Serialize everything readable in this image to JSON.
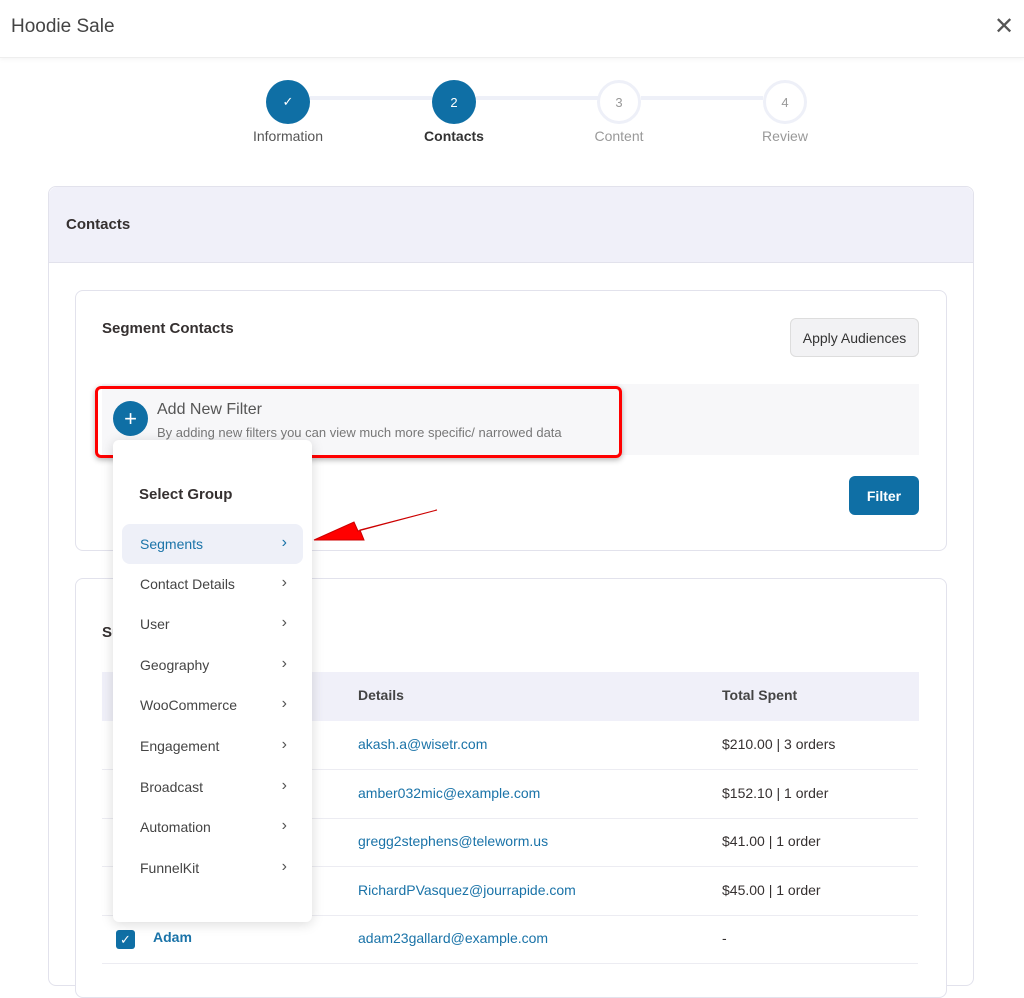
{
  "header": {
    "title": "Hoodie Sale",
    "close_icon": "close-icon"
  },
  "stepper": {
    "steps": [
      {
        "label": "Information",
        "number": "✓",
        "state": "completed"
      },
      {
        "label": "Contacts",
        "number": "2",
        "state": "active"
      },
      {
        "label": "Content",
        "number": "3",
        "state": "pending"
      },
      {
        "label": "Review",
        "number": "4",
        "state": "pending"
      }
    ]
  },
  "contacts": {
    "title": "Contacts",
    "segment": {
      "title": "Segment Contacts",
      "apply_label": "Apply Audiences",
      "add_filter_title": "Add New Filter",
      "add_filter_desc": "By adding new filters you can view much more specific/ narrowed data",
      "filter_label": "Filter"
    },
    "summary": {
      "title_partial": "Su",
      "columns": [
        "Details",
        "Total Spent"
      ],
      "rows": [
        {
          "name": "",
          "email": "akash.a@wisetr.com",
          "spent": "$210.00 | 3 orders"
        },
        {
          "name": "",
          "email": "amber032mic@example.com",
          "spent": "$152.10 | 1 order"
        },
        {
          "name": "",
          "email": "gregg2stephens@teleworm.us",
          "spent": "$41.00 | 1 order"
        },
        {
          "name": "",
          "email": "RichardPVasquez@jourrapide.com",
          "spent": "$45.00 | 1 order"
        },
        {
          "name": "Adam",
          "email": "adam23gallard@example.com",
          "spent": "-",
          "checked": true
        }
      ]
    }
  },
  "dropdown": {
    "title": "Select Group",
    "items": [
      {
        "label": "Segments",
        "active": true
      },
      {
        "label": "Contact Details"
      },
      {
        "label": "User"
      },
      {
        "label": "Geography"
      },
      {
        "label": "WooCommerce"
      },
      {
        "label": "Engagement"
      },
      {
        "label": "Broadcast"
      },
      {
        "label": "Automation"
      },
      {
        "label": "FunnelKit"
      }
    ]
  },
  "colors": {
    "primary": "#0f6fa5",
    "annotation": "#ff0000"
  }
}
